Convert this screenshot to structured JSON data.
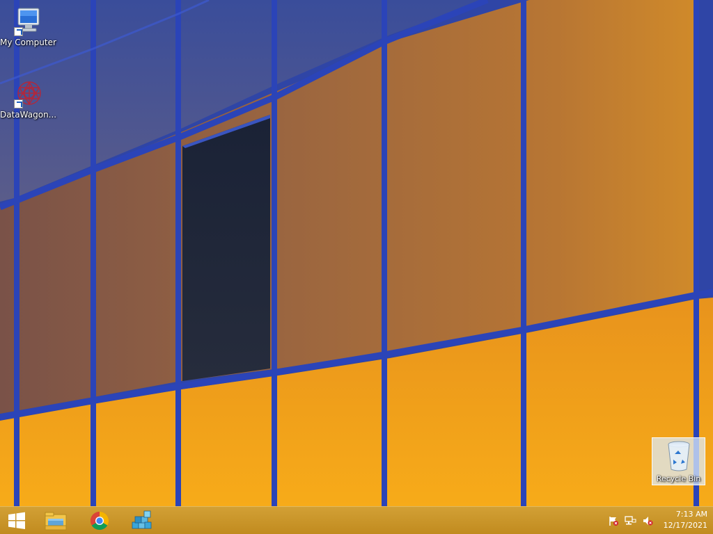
{
  "desktop": {
    "icons": [
      {
        "label": "My Computer",
        "icon": "computer-icon"
      },
      {
        "label": "DataWagon...",
        "icon": "datawagon-icon"
      }
    ],
    "recycle_bin": {
      "label": "Recycle Bin",
      "icon": "recycle-bin-icon"
    }
  },
  "taskbar": {
    "start": {
      "icon": "windows-start-icon"
    },
    "pinned": [
      {
        "icon": "file-explorer-icon"
      },
      {
        "icon": "chrome-icon"
      },
      {
        "icon": "app-blocks-icon"
      }
    ],
    "tray": [
      {
        "icon": "action-center-flag-icon"
      },
      {
        "icon": "network-icon"
      },
      {
        "icon": "volume-muted-icon"
      }
    ],
    "clock": {
      "time": "7:13 AM",
      "date": "12/17/2021"
    }
  },
  "colors": {
    "taskbar": "#c8921f",
    "mullion": "#2b3f9c",
    "glass_upper": "#a0673a",
    "glass_lower": "#f0a11d"
  }
}
